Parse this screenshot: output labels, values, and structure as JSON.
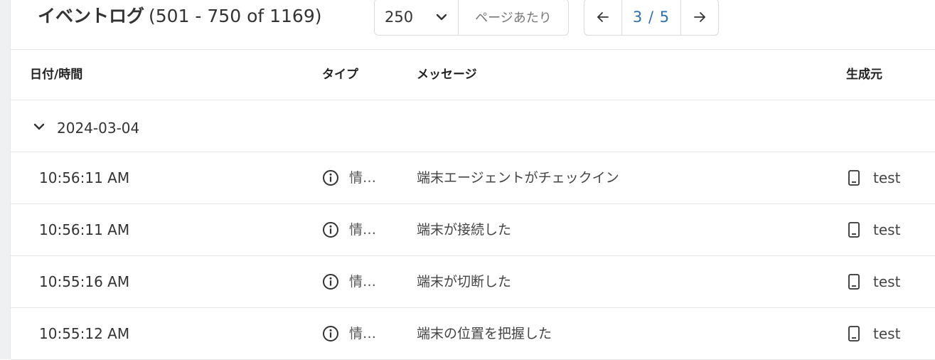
{
  "header": {
    "title": "イベントログ",
    "range": "(501 - 750 of 1169)",
    "per_page": {
      "value": "250",
      "label": "ページあたり"
    },
    "pager": {
      "status": "3 / 5",
      "prev_icon": "arrow-left-icon",
      "next_icon": "arrow-right-icon"
    }
  },
  "columns": {
    "datetime": "日付/時間",
    "type": "タイプ",
    "message": "メッセージ",
    "source": "生成元"
  },
  "group": {
    "date": "2024-03-04",
    "icon": "chevron-down-icon"
  },
  "rows": [
    {
      "time": "10:56:11 AM",
      "type": "情…",
      "message": "端末エージェントがチェックイン",
      "source": "test"
    },
    {
      "time": "10:56:11 AM",
      "type": "情…",
      "message": "端末が接続した",
      "source": "test"
    },
    {
      "time": "10:55:16 AM",
      "type": "情…",
      "message": "端末が切断した",
      "source": "test"
    },
    {
      "time": "10:55:12 AM",
      "type": "情…",
      "message": "端末の位置を把握した",
      "source": "test"
    }
  ],
  "colors": {
    "accent": "#2e6fb0",
    "border": "#e6e6e6",
    "text": "#333333"
  }
}
